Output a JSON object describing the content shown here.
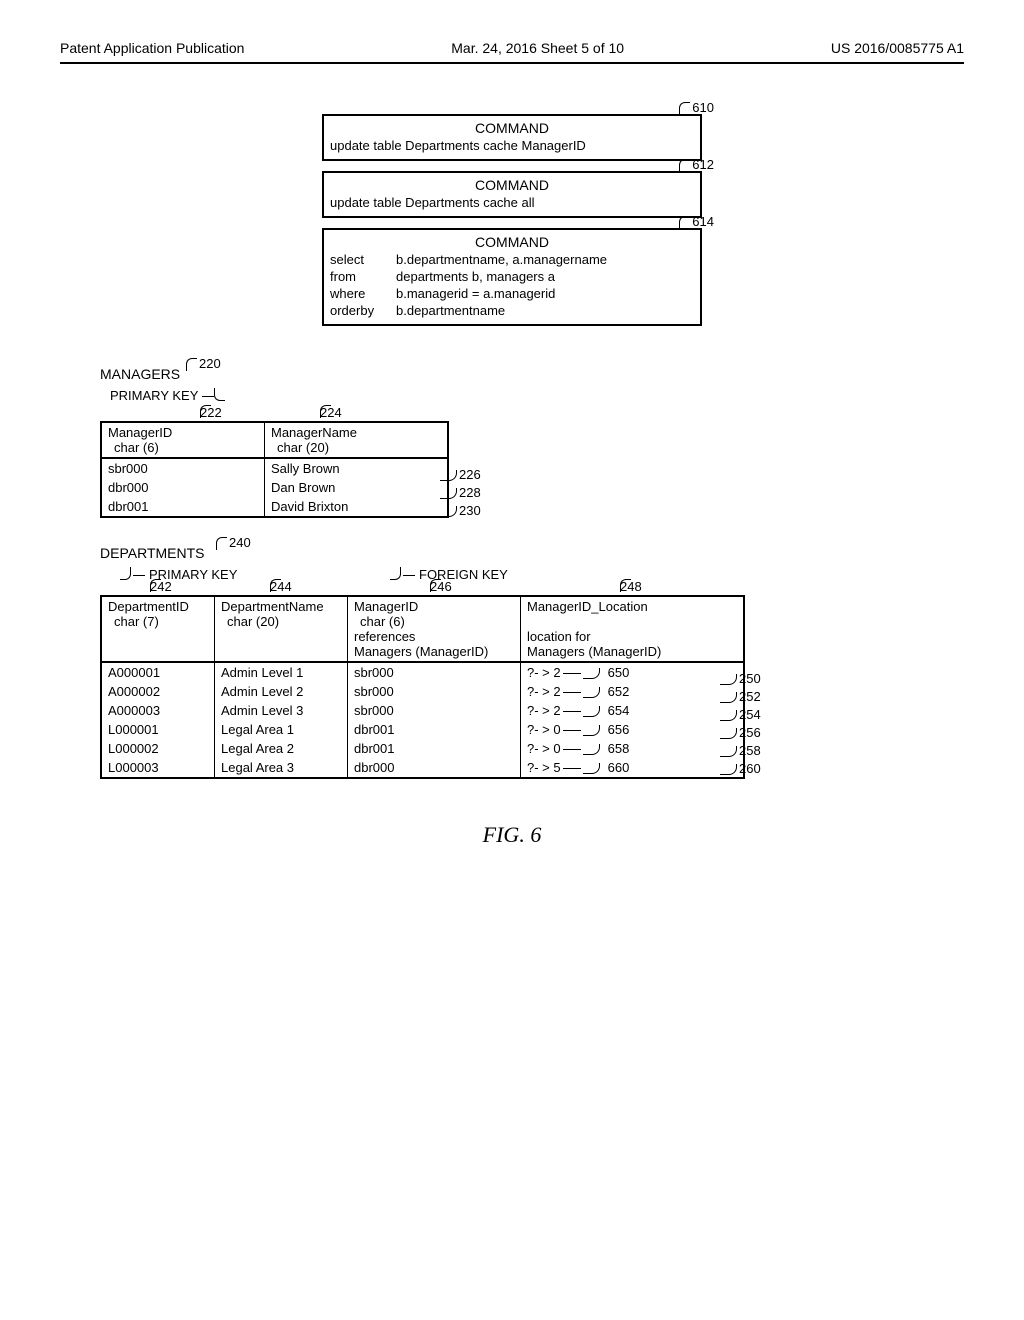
{
  "header": {
    "left": "Patent Application Publication",
    "center": "Mar. 24, 2016  Sheet 5 of 10",
    "right": "US 2016/0085775 A1"
  },
  "commands": {
    "c610": {
      "num": "610",
      "title": "COMMAND",
      "body": "update table Departments cache ManagerID"
    },
    "c612": {
      "num": "612",
      "title": "COMMAND",
      "body": "update table Departments cache all"
    },
    "c614": {
      "num": "614",
      "title": "COMMAND",
      "sql": [
        [
          "select",
          "b.departmentname, a.managername"
        ],
        [
          "from",
          "departments b, managers a"
        ],
        [
          "where",
          "b.managerid = a.managerid"
        ],
        [
          "orderby",
          "b.departmentname"
        ]
      ]
    }
  },
  "managers": {
    "title": "MANAGERS",
    "title_num": "220",
    "pk_label": "PRIMARY KEY",
    "col_nums": [
      "222",
      "224"
    ],
    "headers": [
      {
        "name": "ManagerID",
        "type": "char (6)"
      },
      {
        "name": "ManagerName",
        "type": "char (20)"
      }
    ],
    "rows": [
      {
        "cells": [
          "sbr000",
          "Sally Brown"
        ],
        "num": "226"
      },
      {
        "cells": [
          "dbr000",
          "Dan Brown"
        ],
        "num": "228"
      },
      {
        "cells": [
          "dbr001",
          "David Brixton"
        ],
        "num": "230"
      }
    ]
  },
  "departments": {
    "title": "DEPARTMENTS",
    "title_num": "240",
    "pk_label": "PRIMARY KEY",
    "fk_label": "FOREIGN KEY",
    "col_nums": [
      "242",
      "244",
      "246",
      "248"
    ],
    "headers": [
      {
        "name": "DepartmentID",
        "type": "char (7)"
      },
      {
        "name": "DepartmentName",
        "type": "char (20)"
      },
      {
        "name": "ManagerID",
        "type": "char (6)",
        "extra1": "references",
        "extra2": "Managers (ManagerID)"
      },
      {
        "name": "ManagerID_Location",
        "extra1": "location for",
        "extra2": "Managers (ManagerID)"
      }
    ],
    "rows": [
      {
        "cells": [
          "A000001",
          "Admin Level 1",
          "sbr000"
        ],
        "loc_prefix": "?- > 2",
        "loc_num": "650",
        "row_num": "250"
      },
      {
        "cells": [
          "A000002",
          "Admin Level 2",
          "sbr000"
        ],
        "loc_prefix": "?- > 2",
        "loc_num": "652",
        "row_num": "252"
      },
      {
        "cells": [
          "A000003",
          "Admin Level 3",
          "sbr000"
        ],
        "loc_prefix": "?- > 2",
        "loc_num": "654",
        "row_num": "254"
      },
      {
        "cells": [
          "L000001",
          "Legal Area 1",
          "dbr001"
        ],
        "loc_prefix": "?- > 0",
        "loc_num": "656",
        "row_num": "256"
      },
      {
        "cells": [
          "L000002",
          "Legal Area 2",
          "dbr001"
        ],
        "loc_prefix": "?- > 0",
        "loc_num": "658",
        "row_num": "258"
      },
      {
        "cells": [
          "L000003",
          "Legal Area 3",
          "dbr000"
        ],
        "loc_prefix": "?- > 5",
        "loc_num": "660",
        "row_num": "260"
      }
    ]
  },
  "figure_caption": "FIG. 6"
}
